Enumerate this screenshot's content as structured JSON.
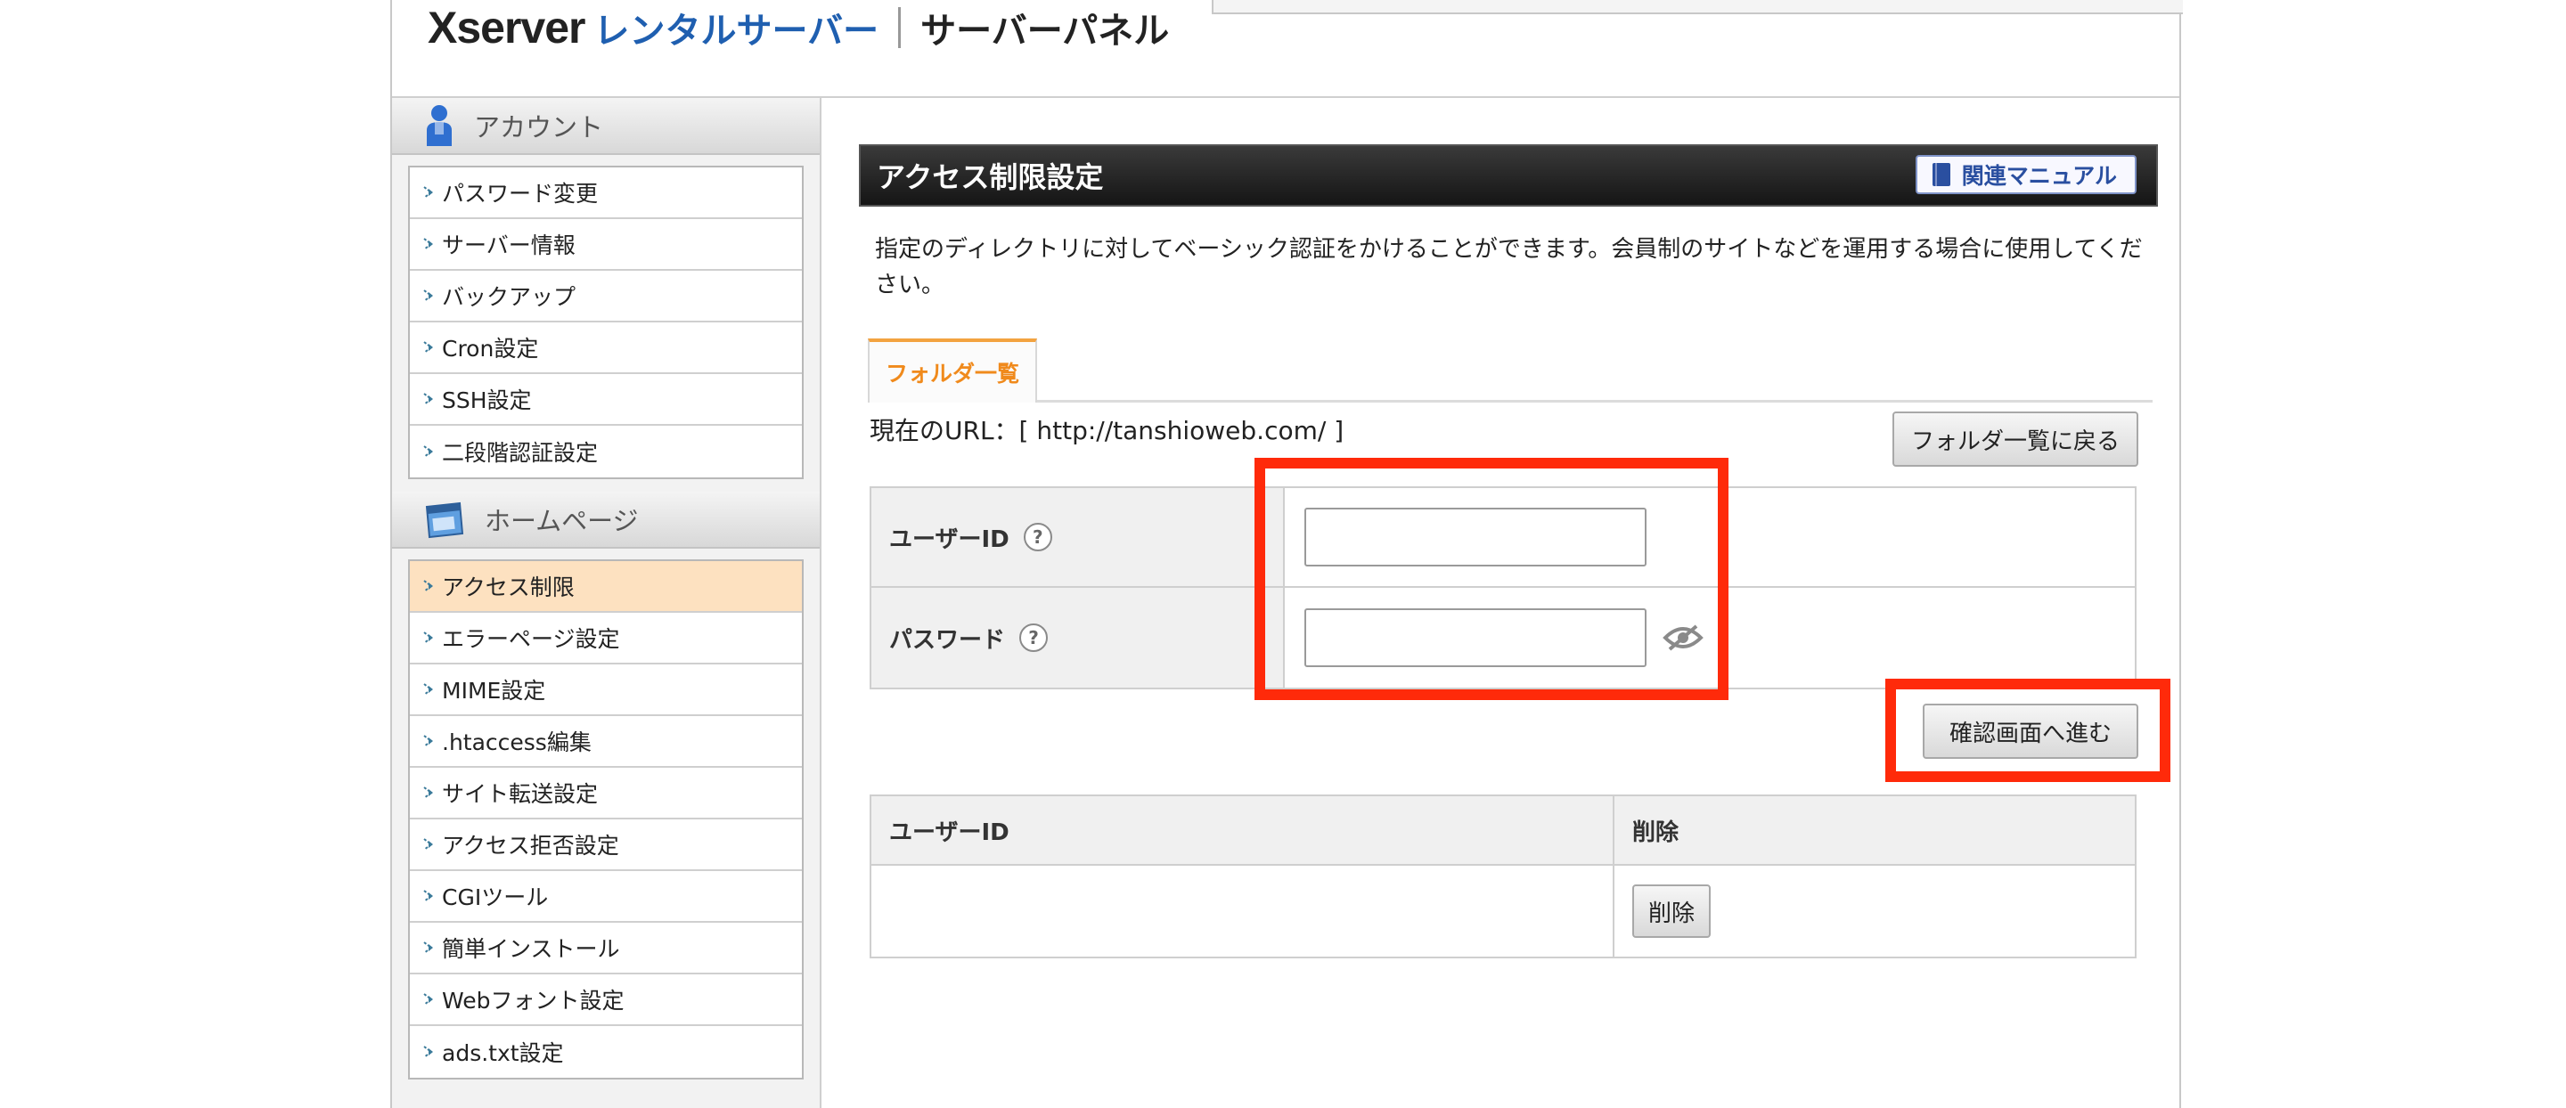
{
  "header": {
    "logo_main": "Xserver",
    "logo_sub": "レンタルサーバー",
    "panel_title": "サーバーパネル"
  },
  "sidebar": {
    "sections": [
      {
        "title": "アカウント",
        "icon": "user-icon",
        "items": [
          {
            "label": "パスワード変更"
          },
          {
            "label": "サーバー情報"
          },
          {
            "label": "バックアップ"
          },
          {
            "label": "Cron設定"
          },
          {
            "label": "SSH設定"
          },
          {
            "label": "二段階認証設定"
          }
        ]
      },
      {
        "title": "ホームページ",
        "icon": "window-icon",
        "items": [
          {
            "label": "アクセス制限",
            "active": true
          },
          {
            "label": "エラーページ設定"
          },
          {
            "label": "MIME設定"
          },
          {
            "label": ".htaccess編集"
          },
          {
            "label": "サイト転送設定"
          },
          {
            "label": "アクセス拒否設定"
          },
          {
            "label": "CGIツール"
          },
          {
            "label": "簡単インストール"
          },
          {
            "label": "Webフォント設定"
          },
          {
            "label": "ads.txt設定"
          }
        ]
      }
    ]
  },
  "main": {
    "title": "アクセス制限設定",
    "manual_label": "関連マニュアル",
    "description": "指定のディレクトリに対してベーシック認証をかけることができます。会員制のサイトなどを運用する場合に使用してください。",
    "tab_label": "フォルダ一覧",
    "current_url": "現在のURL：[ http://tanshioweb.com/ ]",
    "back_label": "フォルダ一覧に戻る",
    "form": {
      "user_id_label": "ユーザーID",
      "user_id_value": "",
      "password_label": "パスワード",
      "password_value": "",
      "help_glyph": "?"
    },
    "confirm_label": "確認画面へ進む",
    "list": {
      "col_user": "ユーザーID",
      "col_delete": "削除",
      "rows": [
        {
          "user": "",
          "delete_label": "削除"
        }
      ]
    }
  },
  "colors": {
    "highlight": "#ff2a0a",
    "tab_accent": "#f08a1c",
    "logo_blue": "#1f5fb0",
    "active_item": "#fde1c0"
  }
}
